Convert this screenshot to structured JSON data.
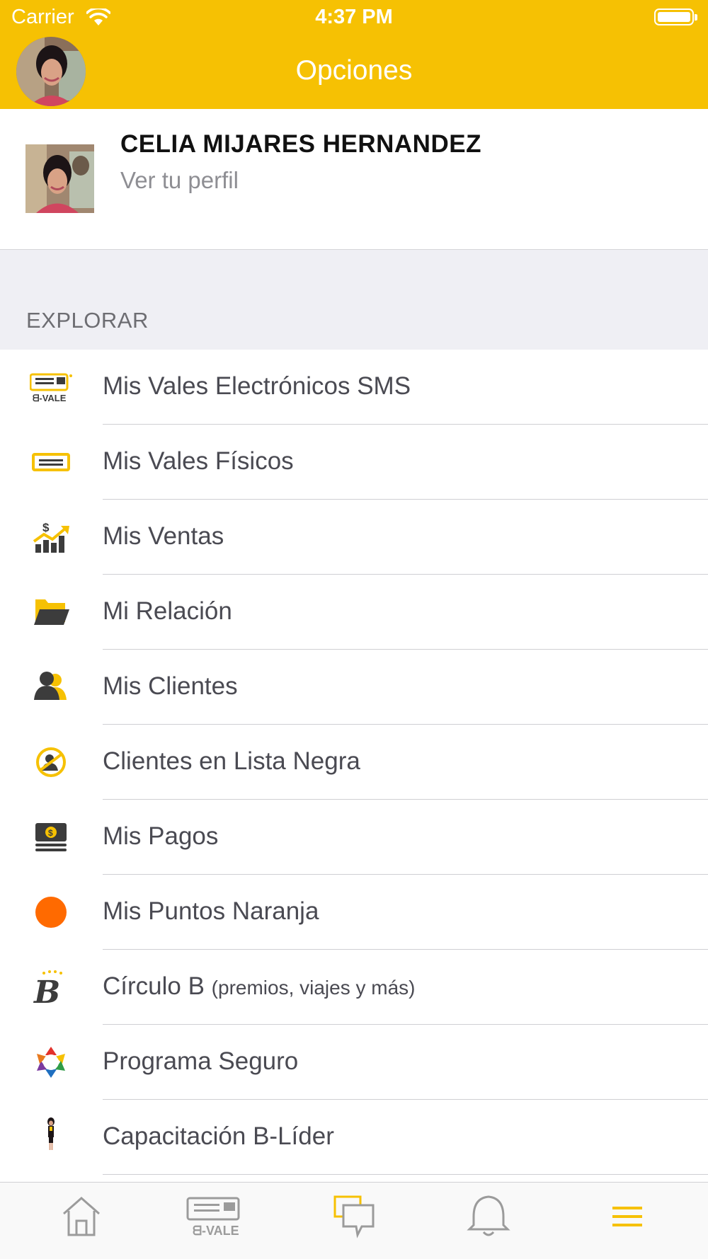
{
  "status_bar": {
    "carrier": "Carrier",
    "time": "4:37 PM"
  },
  "header": {
    "title": "Opciones"
  },
  "profile": {
    "name": "CELIA MIJARES HERNANDEZ",
    "link": "Ver tu perfil"
  },
  "section": {
    "label": "EXPLORAR"
  },
  "menu": [
    {
      "label": "Mis Vales Electrónicos SMS",
      "icon": "bvale-sms-icon"
    },
    {
      "label": "Mis Vales Físicos",
      "icon": "voucher-icon"
    },
    {
      "label": "Mis Ventas",
      "icon": "sales-chart-icon"
    },
    {
      "label": "Mi Relación",
      "icon": "folder-icon"
    },
    {
      "label": "Mis Clientes",
      "icon": "clients-icon"
    },
    {
      "label": "Clientes en Lista Negra",
      "icon": "blacklist-icon"
    },
    {
      "label": "Mis Pagos",
      "icon": "money-icon"
    },
    {
      "label": "Mis Puntos Naranja",
      "icon": "orange-dot-icon"
    },
    {
      "label": "Círculo B",
      "sub": "(premios, viajes y más)",
      "icon": "circulo-b-icon"
    },
    {
      "label": "Programa Seguro",
      "icon": "programa-seguro-icon"
    },
    {
      "label": "Capacitación B-Líder",
      "icon": "leader-figure-icon"
    }
  ],
  "tabbar": {
    "tabs": [
      "home-icon",
      "bvale-icon",
      "chat-icon",
      "bell-icon",
      "menu-icon"
    ],
    "active_color": "#f6c103",
    "inactive_color": "#9b9b9b"
  },
  "colors": {
    "brand": "#f6c103",
    "dark_icon": "#3c3c3c",
    "orange": "#ff6a00"
  }
}
